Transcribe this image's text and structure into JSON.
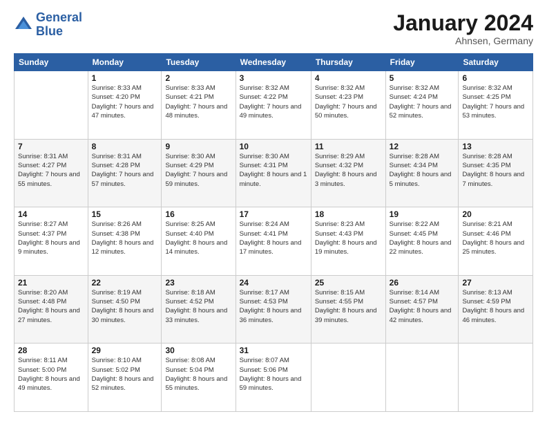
{
  "logo": {
    "line1": "General",
    "line2": "Blue"
  },
  "title": "January 2024",
  "subtitle": "Ahnsen, Germany",
  "days_of_week": [
    "Sunday",
    "Monday",
    "Tuesday",
    "Wednesday",
    "Thursday",
    "Friday",
    "Saturday"
  ],
  "weeks": [
    [
      {
        "day": "",
        "info": ""
      },
      {
        "day": "1",
        "info": "Sunrise: 8:33 AM\nSunset: 4:20 PM\nDaylight: 7 hours\nand 47 minutes."
      },
      {
        "day": "2",
        "info": "Sunrise: 8:33 AM\nSunset: 4:21 PM\nDaylight: 7 hours\nand 48 minutes."
      },
      {
        "day": "3",
        "info": "Sunrise: 8:32 AM\nSunset: 4:22 PM\nDaylight: 7 hours\nand 49 minutes."
      },
      {
        "day": "4",
        "info": "Sunrise: 8:32 AM\nSunset: 4:23 PM\nDaylight: 7 hours\nand 50 minutes."
      },
      {
        "day": "5",
        "info": "Sunrise: 8:32 AM\nSunset: 4:24 PM\nDaylight: 7 hours\nand 52 minutes."
      },
      {
        "day": "6",
        "info": "Sunrise: 8:32 AM\nSunset: 4:25 PM\nDaylight: 7 hours\nand 53 minutes."
      }
    ],
    [
      {
        "day": "7",
        "info": "Sunrise: 8:31 AM\nSunset: 4:27 PM\nDaylight: 7 hours\nand 55 minutes."
      },
      {
        "day": "8",
        "info": "Sunrise: 8:31 AM\nSunset: 4:28 PM\nDaylight: 7 hours\nand 57 minutes."
      },
      {
        "day": "9",
        "info": "Sunrise: 8:30 AM\nSunset: 4:29 PM\nDaylight: 7 hours\nand 59 minutes."
      },
      {
        "day": "10",
        "info": "Sunrise: 8:30 AM\nSunset: 4:31 PM\nDaylight: 8 hours\nand 1 minute."
      },
      {
        "day": "11",
        "info": "Sunrise: 8:29 AM\nSunset: 4:32 PM\nDaylight: 8 hours\nand 3 minutes."
      },
      {
        "day": "12",
        "info": "Sunrise: 8:28 AM\nSunset: 4:34 PM\nDaylight: 8 hours\nand 5 minutes."
      },
      {
        "day": "13",
        "info": "Sunrise: 8:28 AM\nSunset: 4:35 PM\nDaylight: 8 hours\nand 7 minutes."
      }
    ],
    [
      {
        "day": "14",
        "info": "Sunrise: 8:27 AM\nSunset: 4:37 PM\nDaylight: 8 hours\nand 9 minutes."
      },
      {
        "day": "15",
        "info": "Sunrise: 8:26 AM\nSunset: 4:38 PM\nDaylight: 8 hours\nand 12 minutes."
      },
      {
        "day": "16",
        "info": "Sunrise: 8:25 AM\nSunset: 4:40 PM\nDaylight: 8 hours\nand 14 minutes."
      },
      {
        "day": "17",
        "info": "Sunrise: 8:24 AM\nSunset: 4:41 PM\nDaylight: 8 hours\nand 17 minutes."
      },
      {
        "day": "18",
        "info": "Sunrise: 8:23 AM\nSunset: 4:43 PM\nDaylight: 8 hours\nand 19 minutes."
      },
      {
        "day": "19",
        "info": "Sunrise: 8:22 AM\nSunset: 4:45 PM\nDaylight: 8 hours\nand 22 minutes."
      },
      {
        "day": "20",
        "info": "Sunrise: 8:21 AM\nSunset: 4:46 PM\nDaylight: 8 hours\nand 25 minutes."
      }
    ],
    [
      {
        "day": "21",
        "info": "Sunrise: 8:20 AM\nSunset: 4:48 PM\nDaylight: 8 hours\nand 27 minutes."
      },
      {
        "day": "22",
        "info": "Sunrise: 8:19 AM\nSunset: 4:50 PM\nDaylight: 8 hours\nand 30 minutes."
      },
      {
        "day": "23",
        "info": "Sunrise: 8:18 AM\nSunset: 4:52 PM\nDaylight: 8 hours\nand 33 minutes."
      },
      {
        "day": "24",
        "info": "Sunrise: 8:17 AM\nSunset: 4:53 PM\nDaylight: 8 hours\nand 36 minutes."
      },
      {
        "day": "25",
        "info": "Sunrise: 8:15 AM\nSunset: 4:55 PM\nDaylight: 8 hours\nand 39 minutes."
      },
      {
        "day": "26",
        "info": "Sunrise: 8:14 AM\nSunset: 4:57 PM\nDaylight: 8 hours\nand 42 minutes."
      },
      {
        "day": "27",
        "info": "Sunrise: 8:13 AM\nSunset: 4:59 PM\nDaylight: 8 hours\nand 46 minutes."
      }
    ],
    [
      {
        "day": "28",
        "info": "Sunrise: 8:11 AM\nSunset: 5:00 PM\nDaylight: 8 hours\nand 49 minutes."
      },
      {
        "day": "29",
        "info": "Sunrise: 8:10 AM\nSunset: 5:02 PM\nDaylight: 8 hours\nand 52 minutes."
      },
      {
        "day": "30",
        "info": "Sunrise: 8:08 AM\nSunset: 5:04 PM\nDaylight: 8 hours\nand 55 minutes."
      },
      {
        "day": "31",
        "info": "Sunrise: 8:07 AM\nSunset: 5:06 PM\nDaylight: 8 hours\nand 59 minutes."
      },
      {
        "day": "",
        "info": ""
      },
      {
        "day": "",
        "info": ""
      },
      {
        "day": "",
        "info": ""
      }
    ]
  ]
}
